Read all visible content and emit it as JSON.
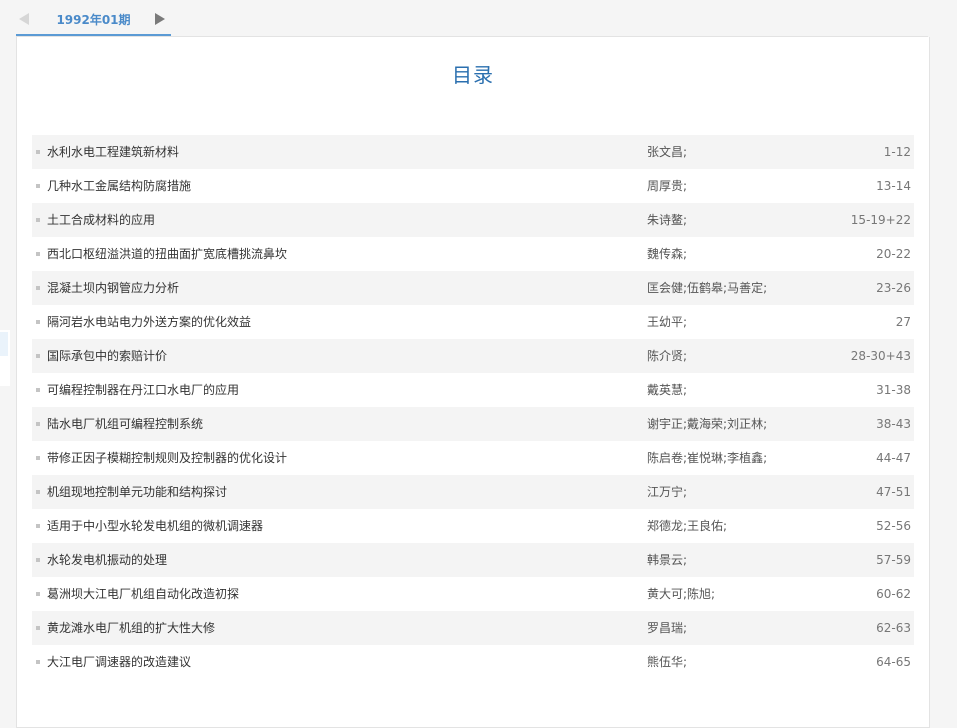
{
  "issue_tab": {
    "label": "1992年01期"
  },
  "catalog_title": "目录",
  "toc": [
    {
      "title": "水利水电工程建筑新材料",
      "authors": "张文昌;",
      "pages": "1-12"
    },
    {
      "title": "几种水工金属结构防腐措施",
      "authors": "周厚贵;",
      "pages": "13-14"
    },
    {
      "title": "土工合成材料的应用",
      "authors": "朱诗鳌;",
      "pages": "15-19+22"
    },
    {
      "title": "西北口枢纽溢洪道的扭曲面扩宽底槽挑流鼻坎",
      "authors": "魏传森;",
      "pages": "20-22"
    },
    {
      "title": "混凝土坝内钢管应力分析",
      "authors": "匡会健;伍鹤皋;马善定;",
      "pages": "23-26"
    },
    {
      "title": "隔河岩水电站电力外送方案的优化效益",
      "authors": "王幼平;",
      "pages": "27"
    },
    {
      "title": "国际承包中的索赔计价",
      "authors": "陈介贤;",
      "pages": "28-30+43"
    },
    {
      "title": "可编程控制器在丹江口水电厂的应用",
      "authors": "戴英慧;",
      "pages": "31-38"
    },
    {
      "title": "陆水电厂机组可编程控制系统",
      "authors": "谢宇正;戴海荣;刘正林;",
      "pages": "38-43"
    },
    {
      "title": "带修正因子模糊控制规则及控制器的优化设计",
      "authors": "陈启卷;崔悦琳;李植鑫;",
      "pages": "44-47"
    },
    {
      "title": "机组现地控制单元功能和结构探讨",
      "authors": "江万宁;",
      "pages": "47-51"
    },
    {
      "title": "适用于中小型水轮发电机组的微机调速器",
      "authors": "郑德龙;王良佑;",
      "pages": "52-56"
    },
    {
      "title": "水轮发电机振动的处理",
      "authors": "韩景云;",
      "pages": "57-59"
    },
    {
      "title": "葛洲坝大江电厂机组自动化改造初探",
      "authors": "黄大可;陈旭;",
      "pages": "60-62"
    },
    {
      "title": "黄龙滩水电厂机组的扩大性大修",
      "authors": "罗昌瑞;",
      "pages": "62-63"
    },
    {
      "title": "大江电厂调速器的改造建议",
      "authors": "熊伍华;",
      "pages": "64-65"
    }
  ],
  "colors": {
    "accent": "#2a6faf",
    "tab_underline": "#5b9bd5",
    "row_alt": "#f4f4f4"
  }
}
